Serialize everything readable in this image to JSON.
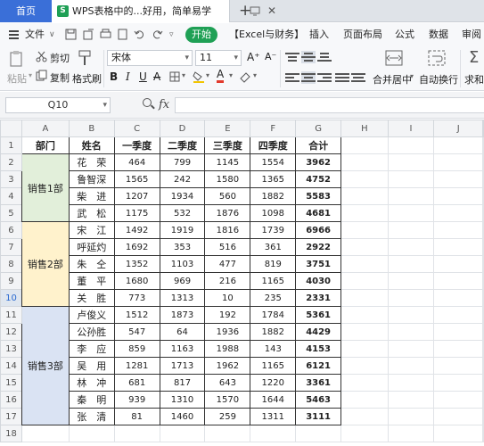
{
  "tabs": {
    "home": "首页",
    "doc_title": "WPS表格中的...好用，简单易学",
    "close": "✕",
    "add": "+"
  },
  "menu": {
    "file": "文件",
    "start": "开始",
    "items": [
      "【Excel与财务】",
      "插入",
      "页面布局",
      "公式",
      "数据",
      "审阅"
    ]
  },
  "ribbon": {
    "paste": "粘贴",
    "cut": "剪切",
    "copy": "复制",
    "format_painter": "格式刷",
    "font_name": "宋体",
    "font_size": "11",
    "merge_center": "合并居中",
    "wrap_text": "自动换行",
    "sum": "求和"
  },
  "formula_bar": {
    "name_box": "Q10",
    "fx": "fx",
    "value": ""
  },
  "columns": [
    "A",
    "B",
    "C",
    "D",
    "E",
    "F",
    "G",
    "H",
    "I",
    "J"
  ],
  "selected_row": 10,
  "table": {
    "headers": [
      "部门",
      "姓名",
      "一季度",
      "二季度",
      "三季度",
      "四季度",
      "合计"
    ],
    "groups": [
      {
        "dept": "销售1部",
        "color": "#e2efda",
        "rows": [
          [
            "花　荣",
            "464",
            "799",
            "1145",
            "1554",
            "3962"
          ],
          [
            "鲁智深",
            "1565",
            "242",
            "1580",
            "1365",
            "4752"
          ],
          [
            "柴　进",
            "1207",
            "1934",
            "560",
            "1882",
            "5583"
          ],
          [
            "武　松",
            "1175",
            "532",
            "1876",
            "1098",
            "4681"
          ]
        ]
      },
      {
        "dept": "销售2部",
        "color": "#fff2cc",
        "rows": [
          [
            "宋　江",
            "1492",
            "1919",
            "1816",
            "1739",
            "6966"
          ],
          [
            "呼延灼",
            "1692",
            "353",
            "516",
            "361",
            "2922"
          ],
          [
            "朱　仝",
            "1352",
            "1103",
            "477",
            "819",
            "3751"
          ],
          [
            "董　平",
            "1680",
            "969",
            "216",
            "1165",
            "4030"
          ],
          [
            "关　胜",
            "773",
            "1313",
            "10",
            "235",
            "2331"
          ]
        ]
      },
      {
        "dept": "销售3部",
        "color": "#dae3f3",
        "rows": [
          [
            "卢俊义",
            "1512",
            "1873",
            "192",
            "1784",
            "5361"
          ],
          [
            "公孙胜",
            "547",
            "64",
            "1936",
            "1882",
            "4429"
          ],
          [
            "李　应",
            "859",
            "1163",
            "1988",
            "143",
            "4153"
          ],
          [
            "吴　用",
            "1281",
            "1713",
            "1962",
            "1165",
            "6121"
          ],
          [
            "林　冲",
            "681",
            "817",
            "643",
            "1220",
            "3361"
          ],
          [
            "秦　明",
            "939",
            "1310",
            "1570",
            "1644",
            "5463"
          ],
          [
            "张　清",
            "81",
            "1460",
            "259",
            "1311",
            "3111"
          ]
        ]
      }
    ]
  }
}
